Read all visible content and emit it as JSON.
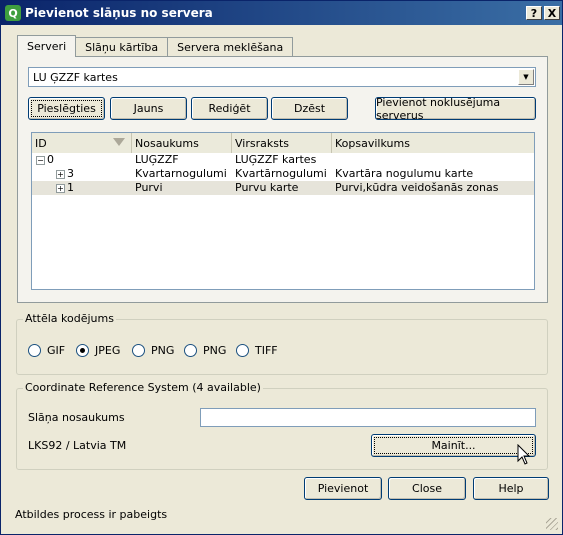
{
  "window": {
    "title": "Pievienot slāņus no servera",
    "help_btn": "?",
    "close_btn": "X"
  },
  "tabs": [
    {
      "label": "Serveri",
      "active": true
    },
    {
      "label": "Slāņu kārtība",
      "active": false
    },
    {
      "label": "Servera meklēšana",
      "active": false
    }
  ],
  "server_combo": {
    "value": "LU ĢZZF kartes"
  },
  "buttons": {
    "connect": "Pieslēgties",
    "new": "Jauns",
    "edit": "Rediģēt",
    "delete": "Dzēst",
    "add_default": "Pievienot noklusējuma serverus"
  },
  "tree": {
    "columns": [
      "ID",
      "Nosaukums",
      "Virsraksts",
      "Kopsavilkums"
    ],
    "rows": [
      {
        "id": "0",
        "name": "LUĢZZF",
        "title": "LUĢZZF kartes",
        "summary": "",
        "expander": "⊟",
        "level": 0
      },
      {
        "id": "3",
        "name": "Kvartarnogulumi",
        "title": "Kvartārnogulumi",
        "summary": "Kvartāra nogulumu karte",
        "expander": "⊞",
        "level": 1
      },
      {
        "id": "1",
        "name": "Purvi",
        "title": "Purvu karte",
        "summary": "Purvi,kūdra veidošanās zonas",
        "expander": "⊞",
        "level": 1
      }
    ]
  },
  "image_encoding": {
    "legend": "Attēla kodējums",
    "options": [
      "GIF",
      "JPEG",
      "PNG",
      "PNG",
      "TIFF"
    ],
    "selected_index": 1
  },
  "crs": {
    "legend": "Coordinate Reference System (4 available)",
    "layer_name_label": "Slāņa nosaukums",
    "layer_name_value": "",
    "current_crs": "LKS92 / Latvia TM",
    "change_button": "Mainīt..."
  },
  "footer": {
    "add": "Pievienot",
    "close": "Close",
    "help": "Help"
  },
  "status": "Atbildes process ir pabeigts",
  "icons": {
    "app": "qgis-q-icon",
    "cursor": "mouse-pointer-icon"
  }
}
